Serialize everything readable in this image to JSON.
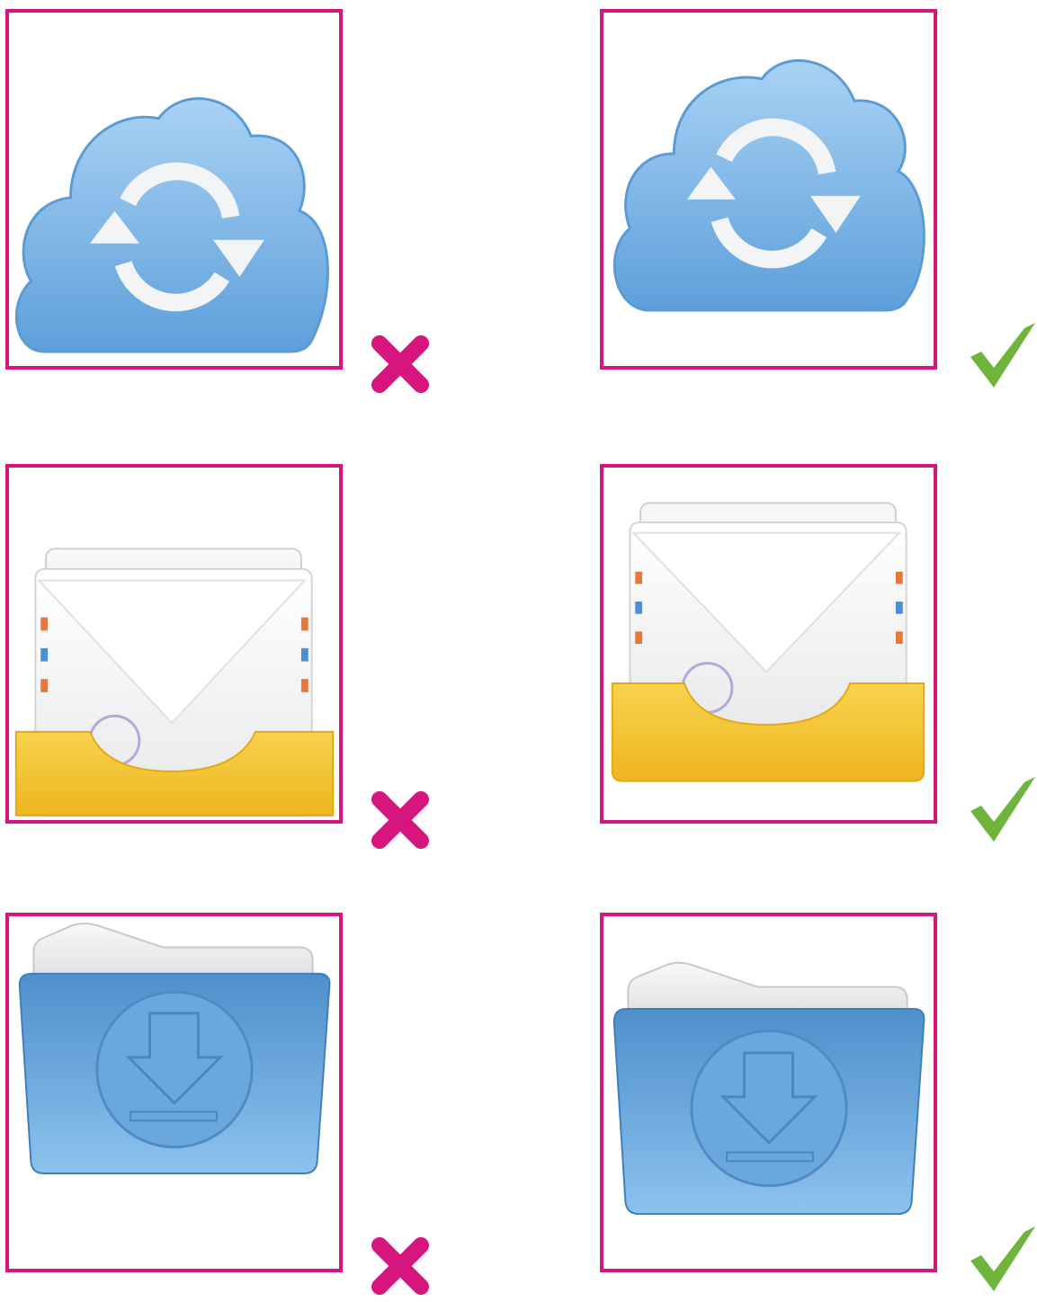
{
  "colors": {
    "frame": "#d6157f",
    "cross": "#d6157f",
    "check": "#6fb43c",
    "cloud": "#76b3e6",
    "folder": "#5b9bd3",
    "tray": "#f4c430"
  },
  "examples": [
    {
      "icon": "cloud-sync-icon",
      "verdict": "incorrect",
      "mark": "cross-icon"
    },
    {
      "icon": "cloud-sync-icon",
      "verdict": "correct",
      "mark": "check-icon"
    },
    {
      "icon": "mail-inbox-icon",
      "verdict": "incorrect",
      "mark": "cross-icon"
    },
    {
      "icon": "mail-inbox-icon",
      "verdict": "correct",
      "mark": "check-icon"
    },
    {
      "icon": "download-folder-icon",
      "verdict": "incorrect",
      "mark": "cross-icon"
    },
    {
      "icon": "download-folder-icon",
      "verdict": "correct",
      "mark": "check-icon"
    }
  ]
}
